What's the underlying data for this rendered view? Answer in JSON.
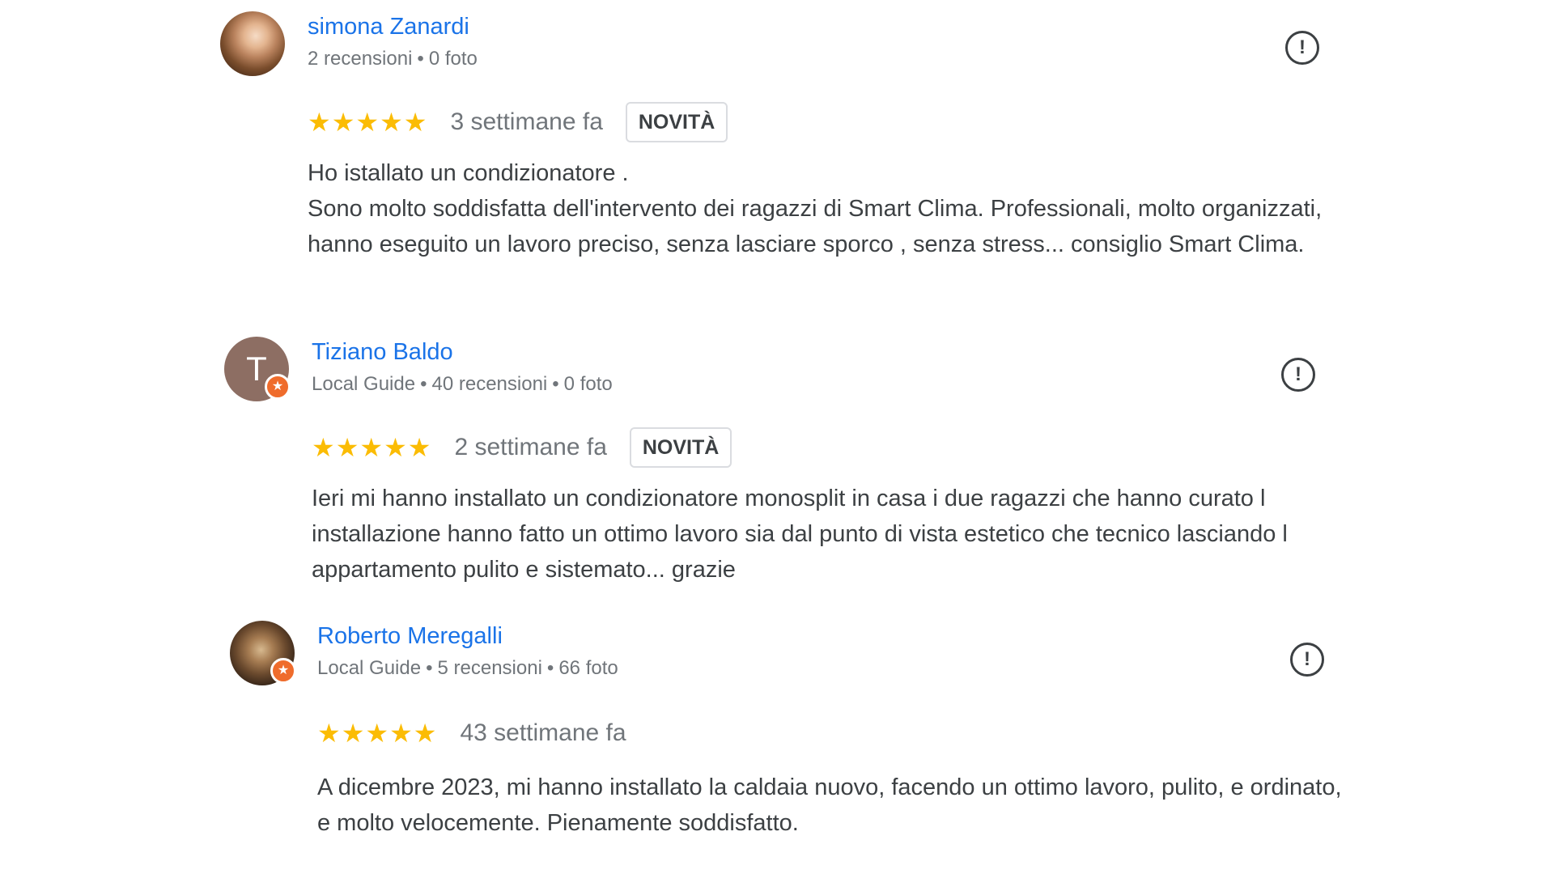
{
  "reviews": [
    {
      "author": "simona Zanardi",
      "meta": [
        "2 recensioni",
        "0 foto"
      ],
      "rating": 5,
      "stars": "★★★★★",
      "date": "3 settimane fa",
      "badge": "NOVITÀ",
      "text": "Ho istallato un condizionatore .\nSono molto soddisfatta dell'intervento dei ragazzi di Smart Clima. Professionali, molto organizzati, hanno eseguito un lavoro preciso, senza lasciare sporco , senza stress... consiglio Smart Clima."
    },
    {
      "author": "Tiziano Baldo",
      "avatar_letter": "T",
      "meta": [
        "Local Guide",
        "40 recensioni",
        "0 foto"
      ],
      "rating": 5,
      "stars": "★★★★★",
      "date": "2 settimane fa",
      "badge": "NOVITÀ",
      "text": "Ieri mi hanno installato un condizionatore monosplit in casa i due ragazzi che hanno curato l installazione hanno fatto un ottimo lavoro sia dal punto di vista estetico che tecnico lasciando l appartamento pulito e sistemato... grazie"
    },
    {
      "author": "Roberto Meregalli",
      "meta": [
        "Local Guide",
        "5 recensioni",
        "66 foto"
      ],
      "rating": 5,
      "stars": "★★★★★",
      "date": "43 settimane fa",
      "text": "A dicembre 2023, mi hanno installato la caldaia nuovo, facendo un ottimo lavoro, pulito, e ordinato, e molto velocemente. Pienamente soddisfatto."
    }
  ],
  "icons": {
    "flag": "report-icon",
    "guide_badge": "local-guide-star-icon",
    "report_glyph": "!",
    "guide_glyph": "★"
  },
  "colors": {
    "author_link": "#1a73e8",
    "stars": "#fbbc04",
    "local_guide_badge": "#ef6c2c"
  }
}
